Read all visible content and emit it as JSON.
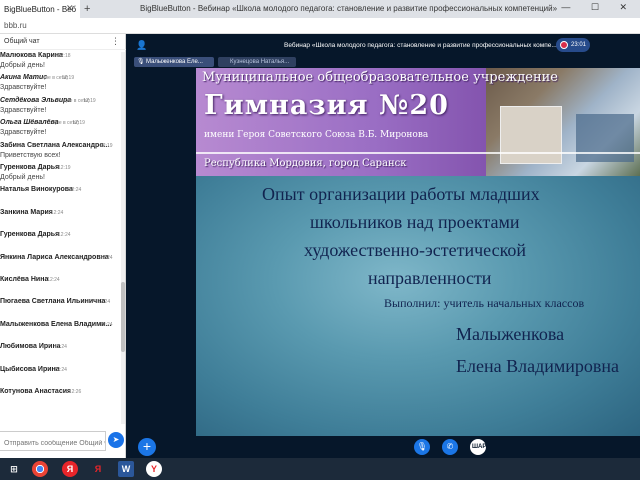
{
  "browser": {
    "tab_title": "BigBlueButton - Веб",
    "tab_close": "✕",
    "new_tab": "+",
    "window_title": "BigBlueButton - Вебинар «Школа молодого педагога: становление и развитие профессиональных компетенций»",
    "window_controls": "— ☐ ✕",
    "url": "bbb.ru"
  },
  "chat": {
    "title": "Общий чат",
    "menu_glyph": "⋮",
    "messages": [
      {
        "name": "Малюкова Карина",
        "time": "12:18",
        "text": "Добрый день!",
        "guest": false
      },
      {
        "name": "Акина Матис",
        "time": "12:19",
        "text": "Здравствуйте!",
        "guest": true,
        "guest_label": "(не в сети)"
      },
      {
        "name": "Сетдёкова Эльвира",
        "time": "12:19",
        "text": "Здравствуйте!",
        "guest": true,
        "guest_label": "(не в сети)"
      },
      {
        "name": "Ольга Шёвалёва",
        "time": "12:19",
        "text": "Здравствуйте!",
        "guest": true,
        "guest_label": "(не в сети)"
      },
      {
        "name": "Забина Светлана Александро...",
        "time": "12:19",
        "text": "Приветствую всех!",
        "guest": false
      },
      {
        "name": "Гуренкова Дарья",
        "time": "12:19",
        "text": "Добрый день!",
        "guest": false
      },
      {
        "name": "Наталья Винокурова",
        "time": "12:24",
        "text": "",
        "guest": false
      },
      {
        "name": "Занкина Мария",
        "time": "12:24",
        "text": "",
        "guest": false
      },
      {
        "name": "Гуренкова Дарья",
        "time": "12:24",
        "text": "",
        "guest": false
      },
      {
        "name": "Янкина Лариса Александровна",
        "time": "12:24",
        "text": "",
        "guest": false
      },
      {
        "name": "Кислёва Нина",
        "time": "12:24",
        "text": "",
        "guest": false
      },
      {
        "name": "Пюгаева Светлана Ильинична",
        "time": "12:24",
        "text": "",
        "guest": false
      },
      {
        "name": "Малыженкова Елена Владими...",
        "time": "12:24",
        "text": "",
        "guest": false
      },
      {
        "name": "Любимова Ирина",
        "time": "12:24",
        "text": "",
        "guest": false
      },
      {
        "name": "Цыбисова Ирина",
        "time": "12:24",
        "text": "",
        "guest": false
      },
      {
        "name": "Котунова Анастасия",
        "time": "12:26",
        "text": "",
        "guest": false
      }
    ],
    "input_placeholder": "Отправить сообщение Общий чат",
    "send_glyph": "➤"
  },
  "meeting": {
    "user_glyph": "👤",
    "title": "Вебинар «Школа молодого педагога: становление и развитие профессиональных компе...",
    "recording": "23:01",
    "webcams": [
      {
        "name": "Малыженкова Еле...",
        "active": true
      },
      {
        "name": "Кузнецова Наталья...",
        "active": false
      }
    ],
    "mic_glyph": "🎙"
  },
  "slide": {
    "banner": {
      "line1": "Муниципальное общеобразовательное учреждение",
      "line2": "Гимназия №20",
      "line3": "имени Героя Советского Союза В.Б. Миронова",
      "line4": "Республика Мордовия, город Саранск"
    },
    "lines": [
      "Опыт организации работы младших",
      "школьников над проектами",
      "художественно-эстетической",
      "направленности",
      "Выполнил: учитель начальных классов",
      "Малыженкова",
      "Елена Владимировна"
    ]
  },
  "actions": {
    "plus": "+",
    "mic": "🎙",
    "phone": "✆",
    "share": "ШАР"
  },
  "taskbar": {
    "items": [
      "⊞",
      "",
      "Я",
      "Я",
      "W",
      "Y"
    ]
  },
  "colors": {
    "bbb_dark": "#06172a",
    "bbb_blue": "#1b76e6",
    "slide_text": "#11234f",
    "banner_purple": "#9a6ec4"
  }
}
